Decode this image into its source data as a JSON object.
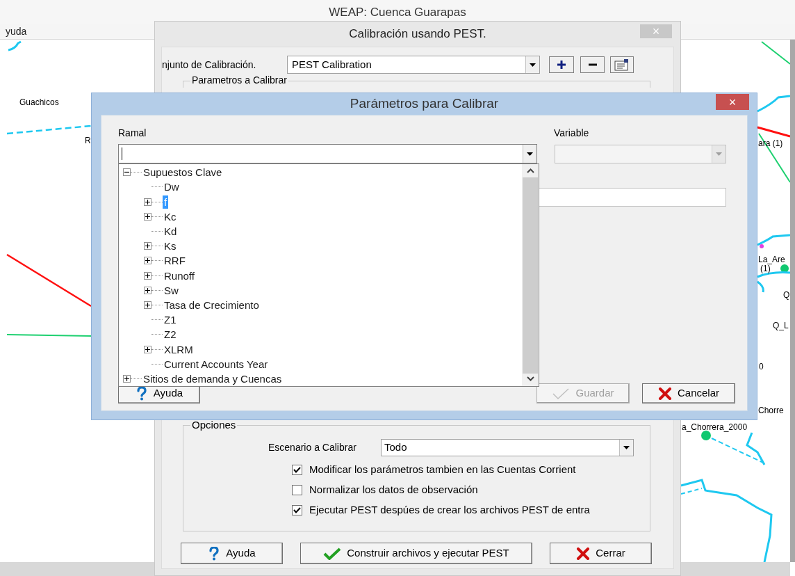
{
  "main_window": {
    "title": "WEAP: Cuenca Guarapas",
    "menu_items": [
      "yuda"
    ],
    "map_labels": [
      "Guachicos",
      "R",
      "ara (1)",
      "La_Are",
      "(1)",
      "Q",
      "Q_L",
      "0",
      "Chorre",
      "a_Chorrera_2000"
    ]
  },
  "calibration_dialog": {
    "title": "Calibración usando PEST.",
    "close": "×",
    "set_label": "njunto de Calibración.",
    "set_value": "PEST Calibration",
    "params_group": "Parametros a Calibrar",
    "options": {
      "title": "Opciones",
      "scenario_label": "Escenario a Calibrar",
      "scenario_value": "Todo",
      "checkboxes": [
        {
          "label": "Modificar los parámetros tambien en las Cuentas Corrient",
          "checked": true
        },
        {
          "label": "Normalizar los datos de observación",
          "checked": false
        },
        {
          "label": "Ejecutar PEST despúes de crear los archivos PEST de entra",
          "checked": true
        }
      ]
    },
    "buttons": [
      {
        "kind": "help",
        "label": "Ayuda"
      },
      {
        "kind": "ok",
        "label": "Construir archivos y ejecutar PEST"
      },
      {
        "kind": "cancel",
        "label": "Cerrar"
      }
    ]
  },
  "params_dialog": {
    "title": "Parámetros para Calibrar",
    "close": "×",
    "branch_label": "Ramal",
    "variable_label": "Variable",
    "variable_disabled": true,
    "tree": [
      {
        "label": "Supuestos Clave",
        "kind": "branch",
        "expanded": true,
        "selected": false,
        "children": [
          {
            "label": "Dw",
            "kind": "leaf",
            "selected": false
          },
          {
            "label": "f",
            "kind": "branch",
            "expanded": false,
            "selected": true
          },
          {
            "label": "Kc",
            "kind": "branch",
            "expanded": false,
            "selected": false
          },
          {
            "label": "Kd",
            "kind": "leaf",
            "selected": false
          },
          {
            "label": "Ks",
            "kind": "branch",
            "expanded": false,
            "selected": false
          },
          {
            "label": "RRF",
            "kind": "branch",
            "expanded": false,
            "selected": false
          },
          {
            "label": "Runoff",
            "kind": "branch",
            "expanded": false,
            "selected": false
          },
          {
            "label": "Sw",
            "kind": "branch",
            "expanded": false,
            "selected": false
          },
          {
            "label": "Tasa de Crecimiento",
            "kind": "branch",
            "expanded": false,
            "selected": false
          },
          {
            "label": "Z1",
            "kind": "leaf",
            "selected": false
          },
          {
            "label": "Z2",
            "kind": "leaf",
            "selected": false
          },
          {
            "label": "XLRM",
            "kind": "branch",
            "expanded": false,
            "selected": false
          },
          {
            "label": "Current Accounts Year",
            "kind": "leaf",
            "selected": false
          }
        ]
      },
      {
        "label": "Sitios de demanda y Cuencas",
        "kind": "branch",
        "expanded": false,
        "selected": false
      }
    ],
    "buttons": [
      {
        "kind": "help",
        "label": "Ayuda",
        "disabled": false
      },
      {
        "kind": "ok",
        "label": "Guardar",
        "disabled": true
      },
      {
        "kind": "cancel",
        "label": "Cancelar",
        "disabled": false
      }
    ]
  }
}
